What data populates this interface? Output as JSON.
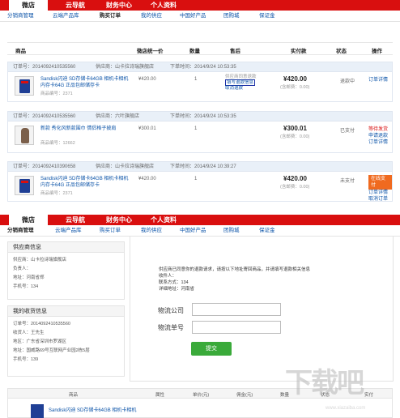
{
  "nav": {
    "tabs": [
      "微店",
      "云导航",
      "财务中心",
      "个人资料"
    ],
    "sub_top": [
      "分销商管理",
      "云端产品库",
      "购买订单",
      "我的供应",
      "中国好产品",
      "团购城",
      "保证金"
    ],
    "sub_bottom": [
      "分销商管理",
      "云端产品库",
      "购买订单",
      "我的供应",
      "中国好产品",
      "团购城",
      "保证金"
    ]
  },
  "table_head": [
    "商品",
    "微店统一价",
    "数量",
    "售后",
    "实付款",
    "状态",
    "操作"
  ],
  "orders": [
    {
      "order_no": "订单号：2014092410535560",
      "supplier": "供应商：山卡拉诗瑞旗舰店",
      "time": "下单时间：2014/9/24 10:53:35",
      "name": "Sandisk闪迪 SD存储卡64GB 相机卡相机内存卡64G 正品包邮储存卡",
      "code": "商品编号：2371",
      "price": "¥420.00",
      "qty": "1",
      "after_1": "供应商同意退款",
      "after_2": "填写退款信息",
      "after_3": "取消退款",
      "paid": "¥420.00",
      "shipping": "(含邮费：0.00)",
      "status": "退款中",
      "op_1": "订单详情"
    },
    {
      "order_no": "订单号：2014092410535560",
      "supplier": "供应商：六叶旗舰店",
      "time": "下单时间：2014/9/24 10:53:35",
      "name": "新款 秀化风新款围巾 情侣格子披肩",
      "code": "商品编号：12662",
      "price": "¥300.01",
      "qty": "1",
      "paid": "¥300.01",
      "shipping": "(含邮费：0.00)",
      "status": "已支付",
      "op_1": "等待发货",
      "op_2": "申请退款",
      "op_3": "订单详情"
    },
    {
      "order_no": "订单号：2014092410390658",
      "supplier": "供应商：山卡拉诗瑞旗舰店",
      "time": "下单时间：2014/9/24 10:39:27",
      "name": "Sandisk闪迪 SD存储卡64GB 相机卡相机内存卡64G 正品包邮储存卡",
      "code": "商品编号：2371",
      "price": "¥420.00",
      "qty": "1",
      "paid": "¥420.00",
      "shipping": "(含邮费：0.00)",
      "status": "未支付",
      "op_btn": "在线支付",
      "op_2": "订单详情",
      "op_3": "取消订单"
    }
  ],
  "supplier_panel": {
    "title": "供应商信息",
    "rows": [
      "供应商：山卡拉诗瑞旗舰店",
      "负责人：",
      "地址：河南省郑",
      "手机号：134"
    ]
  },
  "receiver_panel": {
    "title": "我的收货信息",
    "rows": [
      "订单号：2014092410535560",
      "收货人：王先生",
      "地区：广东省深圳市罗湖区",
      "地址：国威路69号互联网产业园2栋5层",
      "手机号：139"
    ]
  },
  "refund_notice": {
    "line1": "供应商已同意你的退款请求，请按以下地址寄回商品，并请填写退款相关信息",
    "line2": "收件人：",
    "line3": "联系方式：134",
    "line4": "详细地址：河南省"
  },
  "form": {
    "company_label": "物流公司",
    "number_label": "物流单号",
    "submit": "提交"
  },
  "bottom_head": [
    "商品",
    "属性",
    "单价(元)",
    "佣金(元)",
    "数量",
    "状态",
    "实付"
  ],
  "bottom_item": "Sandisk闪迪 SD存储卡64GB 相机卡相机",
  "watermark": {
    "big": "下载吧",
    "url": "www.xiazaiba.com"
  }
}
